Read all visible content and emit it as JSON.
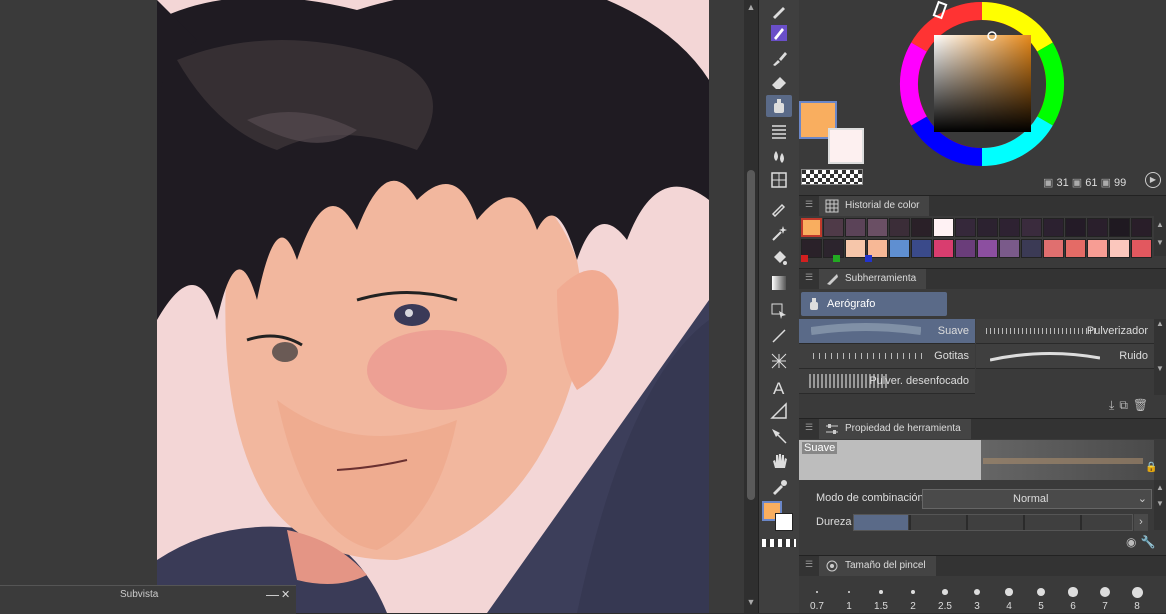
{
  "subview": {
    "title": "Subvista",
    "minimize": "—",
    "close": "✕"
  },
  "color_wheel": {
    "values": [
      "31",
      "61",
      "99"
    ],
    "primary": "#f9ae5f",
    "secondary": "#fdf0f0"
  },
  "color_history": {
    "title": "Historial de color",
    "row1": [
      "#f9ae5f",
      "#4f3a48",
      "#5b4358",
      "#6a4f64",
      "#3b2d38",
      "#2a2028",
      "#fff2f4",
      "#35283a",
      "#2c2230",
      "#2e2232",
      "#3a2b3d",
      "#2c2130",
      "#241b27",
      "#2a1f2c",
      "#1f1921",
      "#291e29"
    ],
    "row2": [
      "#2a2129",
      "#2c242d",
      "#f6c6aa",
      "#f7b896",
      "#5f8fd1",
      "#3a4a8a",
      "#d93d6f",
      "#6a3d7a",
      "#8c4fa0",
      "#7a5a8a",
      "#3b3a55",
      "#e06f6f",
      "#e46b66",
      "#f79d94",
      "#fbc7bd",
      "#e2585f"
    ],
    "markers": [
      "#d21f1f",
      "#22aa22",
      "#2233cc"
    ]
  },
  "subtool": {
    "title": "Subherramienta",
    "selected": "Aerógrafo",
    "brushes": [
      "Suave",
      "Pulverizador",
      "Gotitas",
      "Ruido",
      "Pulver. desenfocado"
    ]
  },
  "tool_property": {
    "title": "Propiedad de herramienta",
    "preset": "Suave",
    "blend_label": "Modo de combinación",
    "blend_value": "Normal",
    "hardness_label": "Dureza"
  },
  "brush_size": {
    "title": "Tamaño del pincel",
    "sizes": [
      "0.7",
      "1",
      "1.5",
      "2",
      "2.5",
      "3",
      "4",
      "5",
      "6",
      "7",
      "8"
    ]
  }
}
